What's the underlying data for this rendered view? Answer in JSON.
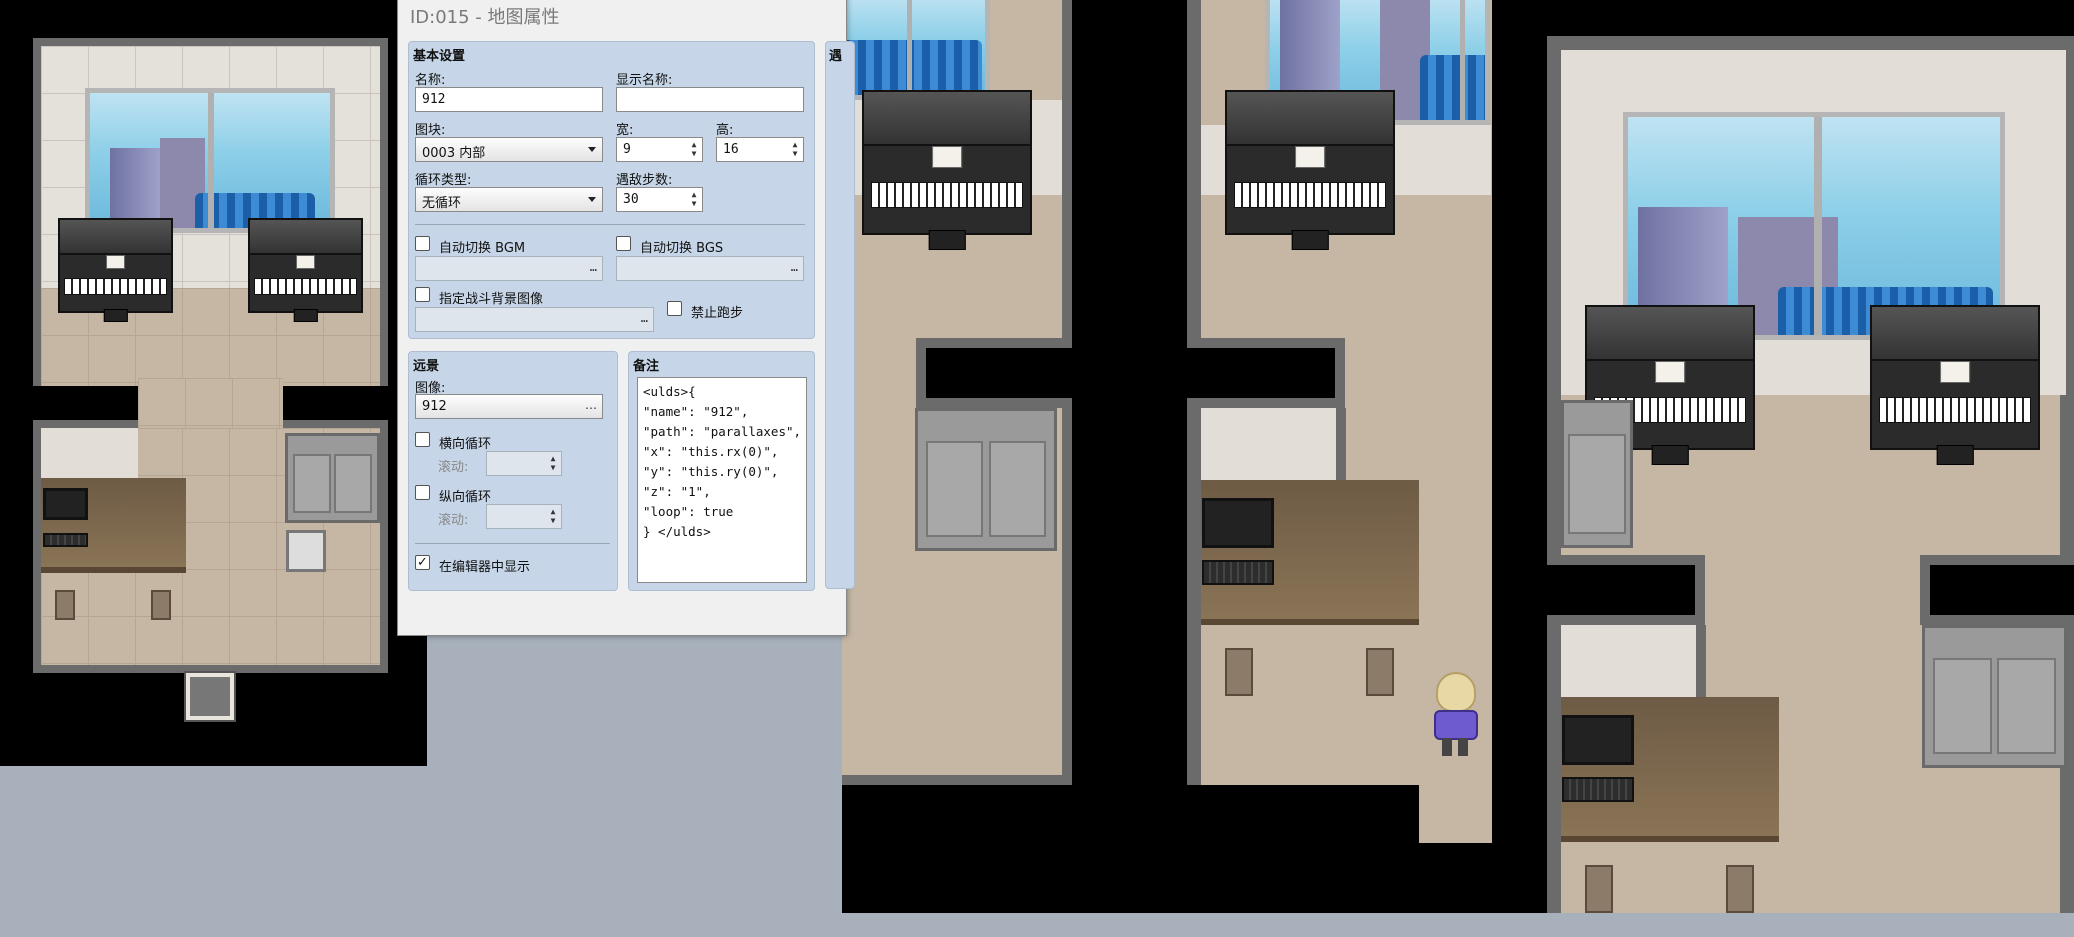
{
  "dialog": {
    "title": "ID:015 - 地图属性",
    "basic": {
      "group_label": "基本设置",
      "name_label": "名称:",
      "name_value": "912",
      "display_name_label": "显示名称:",
      "display_name_value": "",
      "tileset_label": "图块:",
      "tileset_value": "0003 内部",
      "width_label": "宽:",
      "width_value": "9",
      "height_label": "高:",
      "height_value": "16",
      "loop_label": "循环类型:",
      "loop_value": "无循环",
      "encounter_label": "遇敌步数:",
      "encounter_value": "30",
      "auto_bgm_label": "自动切换 BGM",
      "auto_bgs_label": "自动切换 BGS",
      "battleback_label": "指定战斗背景图像",
      "disable_dash_label": "禁止跑步"
    },
    "parallax": {
      "group_label": "远景",
      "image_label": "图像:",
      "image_value": "912",
      "hloop_label": "横向循环",
      "vloop_label": "纵向循环",
      "scroll_label": "滚动:",
      "show_in_editor_label": "在编辑器中显示",
      "show_in_editor_checked": "✓"
    },
    "note": {
      "group_label": "备注",
      "text": "<ulds>{\n\"name\": \"912\",\n\"path\": \"parallaxes\",\n\"x\": \"this.rx(0)\",\n\"y\": \"this.ry(0)\",\n\"z\": \"1\",\n\"loop\": true\n} </ulds>"
    },
    "partial_tab_label": "遇"
  },
  "icons": {
    "ellipsis": "…",
    "spin_up": "▲",
    "spin_down": "▼"
  },
  "colors": {
    "map_black": "#000000",
    "floor": "#c5b7a4",
    "wall_border": "#6b6b6b",
    "dialog_group": "#c6d6e8",
    "desktop": "#a7b0bb"
  }
}
